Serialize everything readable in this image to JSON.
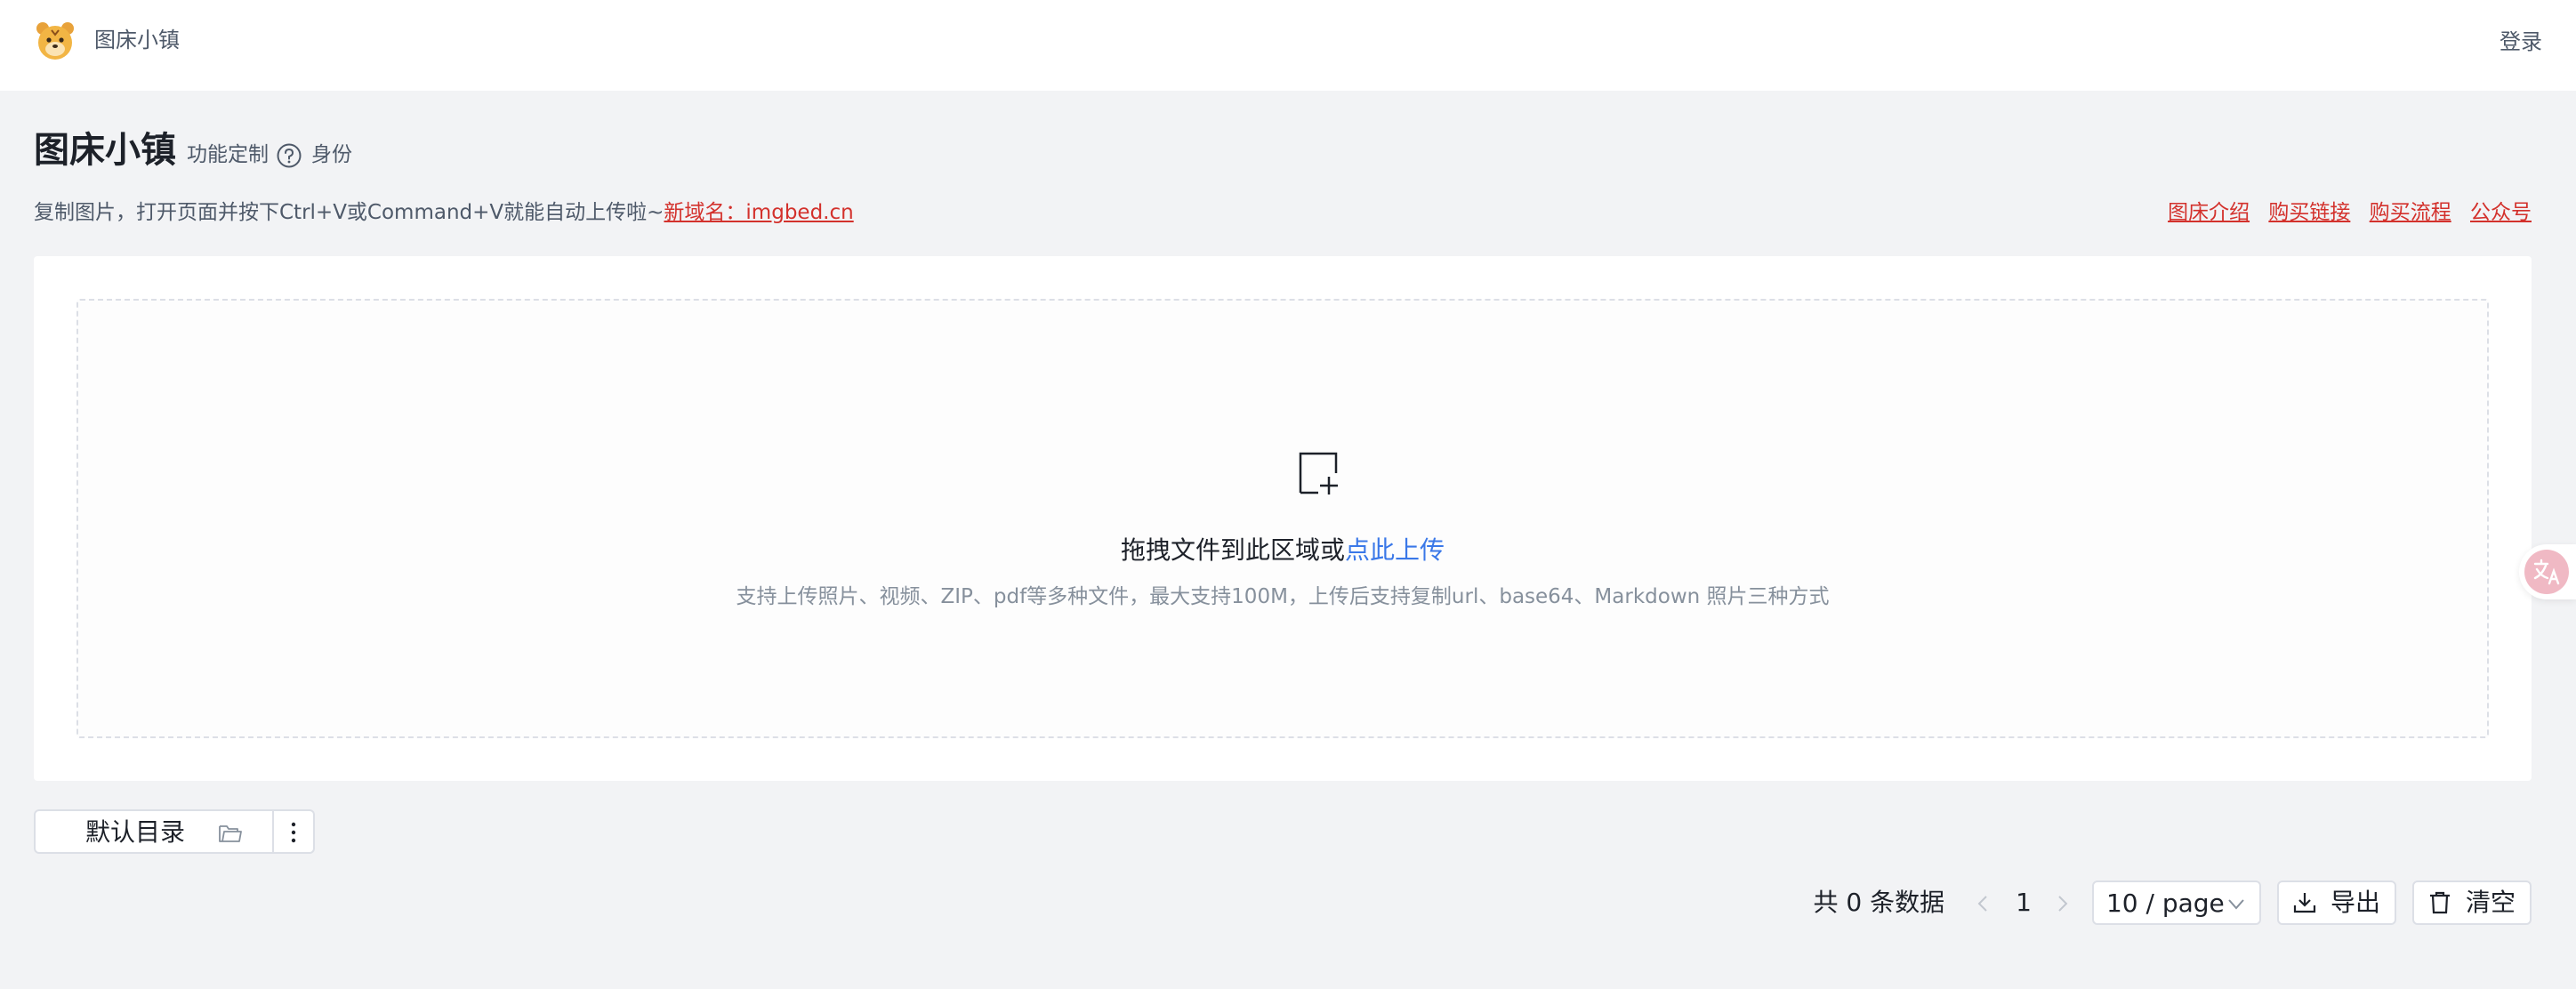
{
  "header": {
    "brand": "图床小镇",
    "login_label": "登录",
    "logo_icon": "tiger-logo-icon"
  },
  "title_row": {
    "title": "图床小镇",
    "feature_label": "功能定制",
    "identity_label": "身份"
  },
  "subtitle": {
    "text": "复制图片，打开页面并按下Ctrl+V或Command+V就能自动上传啦~",
    "domain_link": "新域名：imgbed.cn"
  },
  "right_links": [
    "图床介绍",
    "购买链接",
    "购买流程",
    "公众号"
  ],
  "upload": {
    "drag_text": "拖拽文件到此区域或",
    "click_text": "点此上传",
    "hint": "支持上传照片、视频、ZIP、pdf等多种文件，最大支持100M，上传后支持复制url、base64、Markdown 照片三种方式"
  },
  "directory": {
    "selected": "默认目录"
  },
  "pagination": {
    "total_text": "共 0 条数据",
    "current_page": "1",
    "page_size": "10 / page",
    "export_label": "导出",
    "clear_label": "清空"
  },
  "colors": {
    "accent_blue": "#3a78e8",
    "link_red": "#d3312c",
    "background": "#f2f3f5"
  }
}
